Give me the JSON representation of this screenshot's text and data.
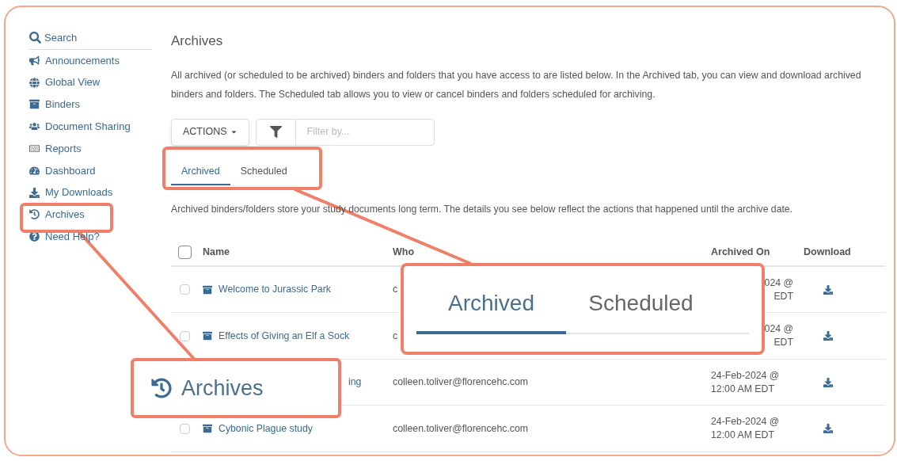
{
  "sidebar": {
    "search": "Search",
    "items": [
      "Announcements",
      "Global View",
      "Binders",
      "Document Sharing",
      "Reports",
      "Dashboard",
      "My Downloads",
      "Archives",
      "Need Help?"
    ]
  },
  "page": {
    "title": "Archives",
    "description": "All archived (or scheduled to be archived) binders and folders that you have access to are listed below. In the Archived tab, you can view and download archived binders and folders. The Scheduled tab allows you to view or cancel binders and folders scheduled for archiving."
  },
  "toolbar": {
    "actions": "ACTIONS",
    "filter_placeholder": "Filter by..."
  },
  "tabs": [
    {
      "label": "Archived",
      "selected": true
    },
    {
      "label": "Scheduled",
      "selected": false
    }
  ],
  "notice": "Archived binders/folders store your study documents long term. The details you see below reflect the actions that happened until the archive date.",
  "table": {
    "select_all_checked": false,
    "columns": [
      "Name",
      "Who",
      "Archived On",
      "Download"
    ],
    "rows": [
      {
        "kind": "who_covered",
        "checked": false,
        "name": "Welcome to Jurassic Park",
        "who": "c",
        "archived_on": [
          "024 @",
          "EDT"
        ]
      },
      {
        "kind": "who_covered",
        "checked": false,
        "name": "Effects of Giving an Elf a Sock",
        "who": "c",
        "archived_on": [
          "024 @",
          "EDT"
        ]
      },
      {
        "kind": "name_covered",
        "name": "ing",
        "who": "colleen.toliver@florencehc.com",
        "archived_on": [
          "24-Feb-2024 @",
          "12:00 AM EDT"
        ]
      },
      {
        "kind": "full",
        "checked": false,
        "name": "Cybonic Plague study",
        "who": "colleen.toliver@florencehc.com",
        "archived_on": [
          "24-Feb-2024 @",
          "12:00 AM EDT"
        ]
      }
    ]
  },
  "callouts": {
    "sidebar_label": "Archives",
    "tabs": [
      {
        "label": "Archived",
        "selected": true
      },
      {
        "label": "Scheduled",
        "selected": false
      }
    ]
  }
}
